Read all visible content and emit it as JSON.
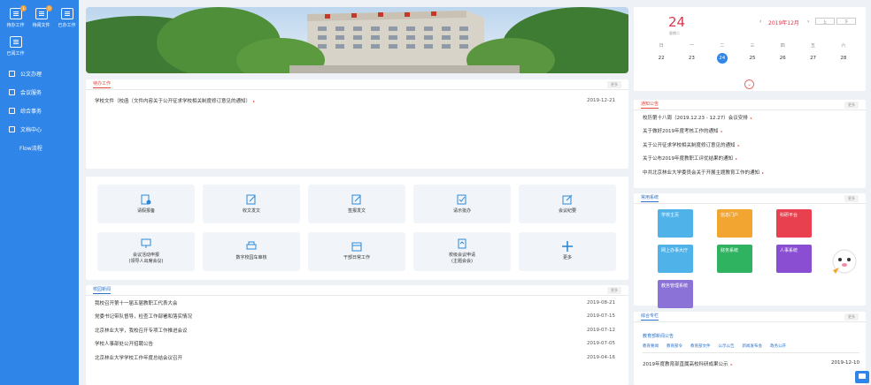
{
  "sidebar": {
    "quick": [
      {
        "label": "待办工作",
        "badge": "1"
      },
      {
        "label": "待阅文件",
        "badge": "0"
      },
      {
        "label": "已办工作",
        "badge": ""
      },
      {
        "label": "已阅工作",
        "badge": ""
      }
    ],
    "nav": [
      {
        "label": "公文办理"
      },
      {
        "label": "会议服务"
      },
      {
        "label": "综合事务"
      },
      {
        "label": "文档中心"
      },
      {
        "label": "Flow流程"
      }
    ]
  },
  "work": {
    "title": "待办工作",
    "more": "更多",
    "items": [
      {
        "title": "学校文件（校函〔文件内容关于公开征求学校相关制度修订意见的通知〕",
        "date": "2019-12-21"
      }
    ]
  },
  "tiles": [
    {
      "label": "请假报备"
    },
    {
      "label": "收文发文"
    },
    {
      "label": "签报发文"
    },
    {
      "label": "请示批办"
    },
    {
      "label": "会议纪要"
    },
    {
      "label": "会议活动申报\n(领导人出席会议)"
    },
    {
      "label": "数字校园车审核"
    },
    {
      "label": "干部日常工作"
    },
    {
      "label": "校级会议申请\n(主题会会)"
    },
    {
      "label": "更多"
    }
  ],
  "news": {
    "title": "校园新闻",
    "more": "更多",
    "items": [
      {
        "title": "我校召开第十一届五届教职工代表大会",
        "date": "2019-08-21"
      },
      {
        "title": "党委书记带队督导，检查工作部署和落实情况",
        "date": "2019-07-15"
      },
      {
        "title": "北京林业大学，我校召开专项工作推进会议",
        "date": "2019-07-12"
      },
      {
        "title": "学校人事部处公开招聘公告",
        "date": "2019-07-05"
      },
      {
        "title": "北京林业大学学校工作年度总结会议召开",
        "date": "2019-04-16"
      }
    ]
  },
  "calendar": {
    "day": "24",
    "weekday": "星期二",
    "month": "2019年12月",
    "prev": "上",
    "next": "下",
    "headers": [
      "日",
      "一",
      "二",
      "三",
      "四",
      "五",
      "六"
    ],
    "days": [
      "22",
      "23",
      "24",
      "25",
      "26",
      "27",
      "28"
    ],
    "today_index": 2
  },
  "notice": {
    "title": "通知公告",
    "more": "更多",
    "items": [
      {
        "title": "校历第十八周（2019.12.23 - 12.27）会议安排"
      },
      {
        "title": "关于做好2019年度考核工作的通知"
      },
      {
        "title": "关于公开征求学校相关制度修订意见的通知"
      },
      {
        "title": "关于公布2019年度教职工评优结果的通知"
      },
      {
        "title": "中共北京林业大学委员会关于开展主题教育工作的通知"
      }
    ]
  },
  "systems": {
    "title": "常用系统",
    "more": "更多",
    "items": [
      {
        "label": "学校主页",
        "color": "#4fb3ea"
      },
      {
        "label": "信息门户",
        "color": "#f2a531"
      },
      {
        "label": "科研平台",
        "color": "#e8404f"
      },
      {
        "label": "网上办事大厅",
        "color": "#4fb3ea"
      },
      {
        "label": "财务系统",
        "color": "#2fb360"
      },
      {
        "label": "人事系统",
        "color": "#8a4ed3"
      },
      {
        "label": "教务管理系统",
        "color": "#8b72d6"
      }
    ]
  },
  "links": {
    "title": "综合专栏",
    "more": "更多",
    "subtitle": "教育部新闻公告",
    "tabs": [
      "教育要闻",
      "教育部令",
      "教育部文件",
      "公示公告",
      "新闻发布会",
      "政务公开"
    ],
    "row": {
      "title": "2019年度教育部直属高校科研成果公示",
      "date": "2019-12-10"
    }
  }
}
